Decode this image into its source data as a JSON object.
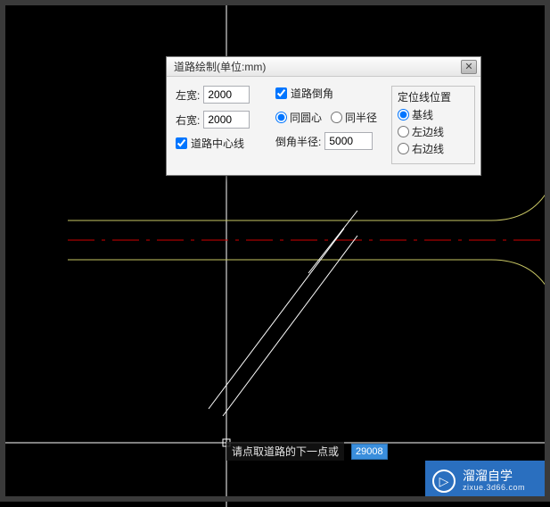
{
  "dialog": {
    "title": "道路绘制(单位:mm)",
    "left_width_label": "左宽:",
    "left_width_value": "2000",
    "right_width_label": "右宽:",
    "right_width_value": "2000",
    "centerline_label": "道路中心线",
    "centerline_checked": true,
    "chamfer_label": "道路倒角",
    "chamfer_checked": true,
    "concentric_label": "同圆心",
    "concentric_checked": true,
    "same_radius_label": "同半径",
    "same_radius_checked": false,
    "radius_label": "倒角半径:",
    "radius_value": "5000",
    "locate_group_label": "定位线位置",
    "opt_base_label": "基线",
    "opt_base_checked": true,
    "opt_left_label": "左边线",
    "opt_left_checked": false,
    "opt_right_label": "右边线",
    "opt_right_checked": false,
    "close_glyph": "✕"
  },
  "prompt": {
    "text": "请点取道路的下一点或",
    "coord": "29008"
  },
  "watermark": {
    "brand": "溜溜自学",
    "url": "zixue.3d66.com",
    "play_glyph": "▷"
  }
}
